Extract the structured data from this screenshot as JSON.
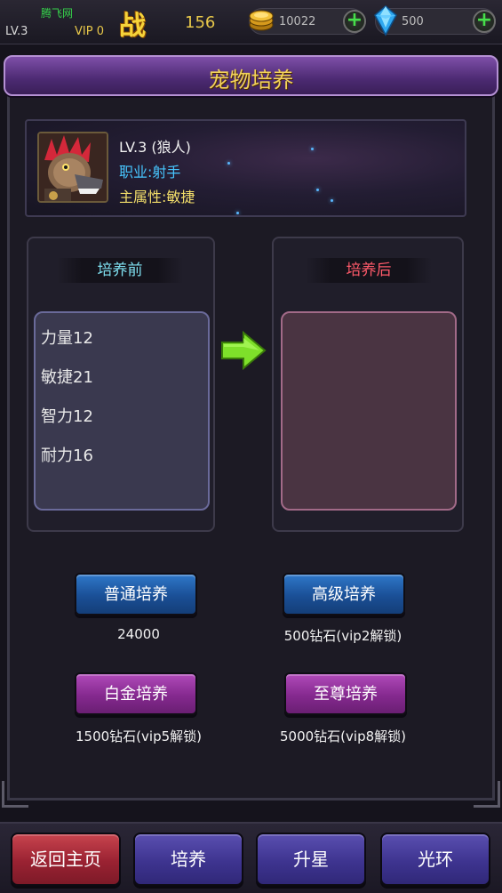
{
  "topbar": {
    "brand": "腾飞网",
    "level": "LV.3",
    "vip": "VIP 0",
    "battle_glyph": "战",
    "power": "156",
    "gold": "10022",
    "gems": "500",
    "plus": "+"
  },
  "title": "宠物培养",
  "pet": {
    "level": "LV.3  (狼人)",
    "job": "职业:射手",
    "main_attr": "主属性:敏捷"
  },
  "before": {
    "label": "培养前",
    "stats": [
      "力量12",
      "敏捷21",
      "智力12",
      "耐力16"
    ]
  },
  "after": {
    "label": "培养后"
  },
  "training": {
    "normal": {
      "label": "普通培养",
      "cost": "24000"
    },
    "advanced": {
      "label": "高级培养",
      "cost": "500钻石(vip2解锁)"
    },
    "platinum": {
      "label": "白金培养",
      "cost": "1500钻石(vip5解锁)"
    },
    "supreme": {
      "label": "至尊培养",
      "cost": "5000钻石(vip8解锁)"
    }
  },
  "nav": {
    "home": "返回主页",
    "train": "培养",
    "star": "升星",
    "aura": "光环"
  },
  "colors": {
    "title_gold": "#f3d25a",
    "job_blue": "#47c6ff",
    "attr_yellow": "#f4df6a",
    "before_cyan": "#7fe0f0",
    "after_red": "#ff5a6a",
    "arrow_green": "#7ee02a"
  },
  "icons": [
    "coin-icon",
    "gem-icon",
    "plus-icon",
    "arrow-right-icon",
    "pet-avatar"
  ]
}
